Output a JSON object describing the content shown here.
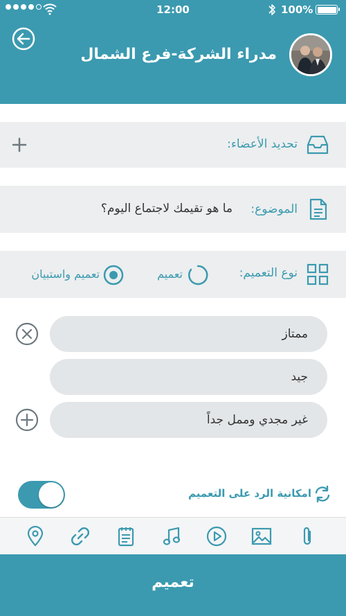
{
  "status_bar": {
    "time": "12:00",
    "battery": "100%"
  },
  "header": {
    "title": "مدراء الشركة-فرع الشمال"
  },
  "members": {
    "label": "تحديد الأعضاء:"
  },
  "subject": {
    "label": "الموضوع:",
    "value": "ما هو تقيمك لاجتماع اليوم؟"
  },
  "broadcast_type": {
    "label": "نوع التعميم:",
    "options": [
      {
        "label": "تعميم",
        "selected": false
      },
      {
        "label": "تعميم واستبيان",
        "selected": true
      }
    ]
  },
  "poll_options": [
    "ممتاز",
    "جيد",
    "غير مجدي وممل جداً"
  ],
  "reply": {
    "label": "امكانية الرد على التعميم",
    "enabled": true
  },
  "attachments": [
    "location-icon",
    "link-icon",
    "calendar-icon",
    "music-icon",
    "video-icon",
    "image-icon",
    "paperclip-icon"
  ],
  "send": {
    "label": "تعميم"
  },
  "colors": {
    "primary": "#3b9ab0",
    "row_bg": "#eceeef",
    "option_bg": "#e3e6e8",
    "icon_gray": "#6e7a80"
  }
}
